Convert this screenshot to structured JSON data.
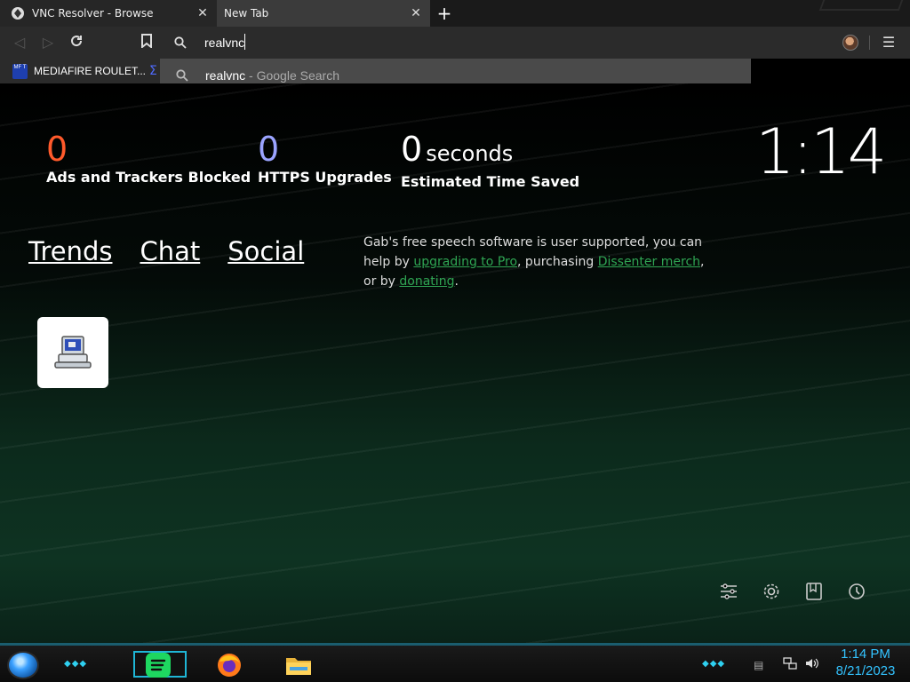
{
  "tabs": [
    {
      "title": "VNC Resolver - Browse",
      "active": false
    },
    {
      "title": "New Tab",
      "active": true
    }
  ],
  "toolbar": {
    "omnibox_value": "realvnc"
  },
  "suggestion": {
    "query": "realvnc",
    "separator": " - ",
    "engine": "Google Search"
  },
  "bookmarks": [
    {
      "label": "MEDIAFIRE ROULET...",
      "favicon_text": "MF T"
    }
  ],
  "stats": {
    "ads_count": "0",
    "ads_label": "Ads and Trackers Blocked",
    "https_count": "0",
    "https_label": "HTTPS Upgrades",
    "time_count": "0",
    "time_unit": "seconds",
    "time_label": "Estimated Time Saved"
  },
  "clock": "1:14",
  "nav_links": [
    "Trends",
    "Chat",
    "Social"
  ],
  "gab": {
    "text1": "Gab's free speech software is user supported, you can help by ",
    "link1": "upgrading to Pro",
    "text2": ", purchasing ",
    "link2": "Dissenter merch",
    "text3": ", or by ",
    "link3": "donating",
    "text4": "."
  },
  "taskbar": {
    "time": "1:14 PM",
    "date": "8/21/2023"
  },
  "colors": {
    "ads": "#ff5a2b",
    "https": "#9ba4ff",
    "gab_link": "#2fa553",
    "taskbar_accent": "#1fb6d6",
    "tray_text": "#33c3ff"
  }
}
